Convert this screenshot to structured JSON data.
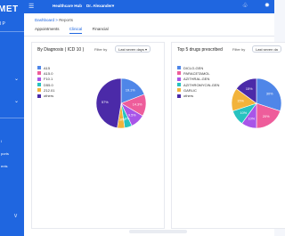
{
  "sidebar": {
    "logo": "MET",
    "org": "l P",
    "nav": [
      {
        "label": "l"
      },
      {
        "label": "ports"
      },
      {
        "label": "ents"
      }
    ]
  },
  "topbar": {
    "title": "Healthcare Hub",
    "user": "Dr. Alexander▾"
  },
  "breadcrumb": {
    "home": "Dashboard",
    "sep": ">",
    "current": "Reports"
  },
  "tabs": [
    {
      "label": "Appointments"
    },
    {
      "label": "Clinical"
    },
    {
      "label": "Financial"
    }
  ],
  "cards": [
    {
      "title": "By Diagnosis ( ICD 10 )",
      "filter_label": "Filter by",
      "filter_value": "Last seven days ▾",
      "legend": [
        {
          "label": "A15",
          "color": "#4f86e8"
        },
        {
          "label": "A15.0",
          "color": "#ee5d9b"
        },
        {
          "label": "F10.1",
          "color": "#a855e8"
        },
        {
          "label": "D55.0",
          "color": "#27c2c0"
        },
        {
          "label": "Z12.01",
          "color": "#f2b33b"
        },
        {
          "label": "others",
          "color": "#4b2aa8"
        }
      ],
      "slices": [
        {
          "label": "19.1%",
          "value": 19.1,
          "color": "#4f86e8"
        },
        {
          "label": "14.3%",
          "value": 14.3,
          "color": "#ee5d9b"
        },
        {
          "label": "9.5%",
          "value": 9.5,
          "color": "#a855e8"
        },
        {
          "label": "4.8%",
          "value": 4.8,
          "color": "#27c2c0"
        },
        {
          "label": "4.8%",
          "value": 4.8,
          "color": "#f2b33b"
        },
        {
          "label": "57%",
          "value": 47.5,
          "color": "#4b2aa8"
        }
      ]
    },
    {
      "title": "Top 5 drugs prescribed",
      "filter_label": "Filter by",
      "filter_value": "Last seven da",
      "legend": [
        {
          "label": "DICLO-GEN",
          "color": "#4f86e8"
        },
        {
          "label": "PARACETAMOL",
          "color": "#ee5d9b"
        },
        {
          "label": "AZITHRAL-GEN",
          "color": "#a855e8"
        },
        {
          "label": "AZITHROMYCIN-GEN",
          "color": "#27c2c0"
        },
        {
          "label": "GARLIC",
          "color": "#f2b33b"
        },
        {
          "label": "others",
          "color": "#4b2aa8"
        }
      ],
      "slices": [
        {
          "label": "30%",
          "value": 30,
          "color": "#4f86e8"
        },
        {
          "label": "20%",
          "value": 20,
          "color": "#ee5d9b"
        },
        {
          "label": "10%",
          "value": 10,
          "color": "#a855e8"
        },
        {
          "label": "10%",
          "value": 10,
          "color": "#27c2c0"
        },
        {
          "label": "15%",
          "value": 15,
          "color": "#f2b33b"
        },
        {
          "label": "15%",
          "value": 15,
          "color": "#4b2aa8"
        }
      ]
    }
  ]
}
